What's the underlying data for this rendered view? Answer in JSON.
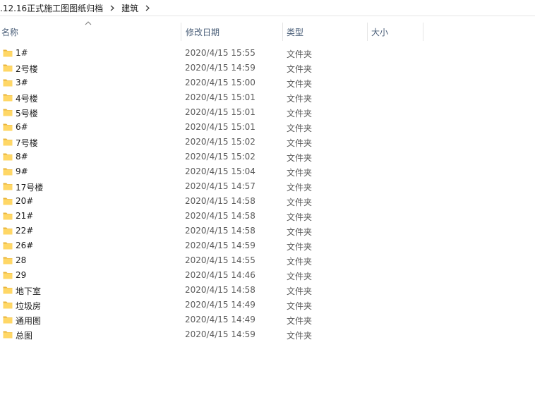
{
  "breadcrumb": {
    "items": [
      ".12.16正式施工图图纸归档",
      "建筑"
    ]
  },
  "columns": {
    "name": "名称",
    "date": "修改日期",
    "type": "类型",
    "size": "大小"
  },
  "files": [
    {
      "name": "1#",
      "date": "2020/4/15 15:55",
      "type": "文件夹"
    },
    {
      "name": "2号楼",
      "date": "2020/4/15 14:59",
      "type": "文件夹"
    },
    {
      "name": "3#",
      "date": "2020/4/15 15:00",
      "type": "文件夹"
    },
    {
      "name": "4号楼",
      "date": "2020/4/15 15:01",
      "type": "文件夹"
    },
    {
      "name": "5号楼",
      "date": "2020/4/15 15:01",
      "type": "文件夹"
    },
    {
      "name": "6#",
      "date": "2020/4/15 15:01",
      "type": "文件夹"
    },
    {
      "name": "7号楼",
      "date": "2020/4/15 15:02",
      "type": "文件夹"
    },
    {
      "name": "8#",
      "date": "2020/4/15 15:02",
      "type": "文件夹"
    },
    {
      "name": "9#",
      "date": "2020/4/15 15:04",
      "type": "文件夹"
    },
    {
      "name": "17号楼",
      "date": "2020/4/15 14:57",
      "type": "文件夹"
    },
    {
      "name": "20#",
      "date": "2020/4/15 14:58",
      "type": "文件夹"
    },
    {
      "name": "21#",
      "date": "2020/4/15 14:58",
      "type": "文件夹"
    },
    {
      "name": "22#",
      "date": "2020/4/15 14:58",
      "type": "文件夹"
    },
    {
      "name": "26#",
      "date": "2020/4/15 14:59",
      "type": "文件夹"
    },
    {
      "name": "28",
      "date": "2020/4/15 14:55",
      "type": "文件夹"
    },
    {
      "name": "29",
      "date": "2020/4/15 14:46",
      "type": "文件夹"
    },
    {
      "name": "地下室",
      "date": "2020/4/15 14:58",
      "type": "文件夹"
    },
    {
      "name": "垃圾房",
      "date": "2020/4/15 14:49",
      "type": "文件夹"
    },
    {
      "name": "通用图",
      "date": "2020/4/15 14:49",
      "type": "文件夹"
    },
    {
      "name": "总图",
      "date": "2020/4/15 14:59",
      "type": "文件夹"
    }
  ],
  "colors": {
    "folder_fill": "#ffd766",
    "folder_tab": "#e8b43d",
    "header_text": "#4c607a"
  },
  "icons": {
    "folder": "folder-icon",
    "sort": "sort-up-icon",
    "separator": "chevron-right-icon"
  }
}
